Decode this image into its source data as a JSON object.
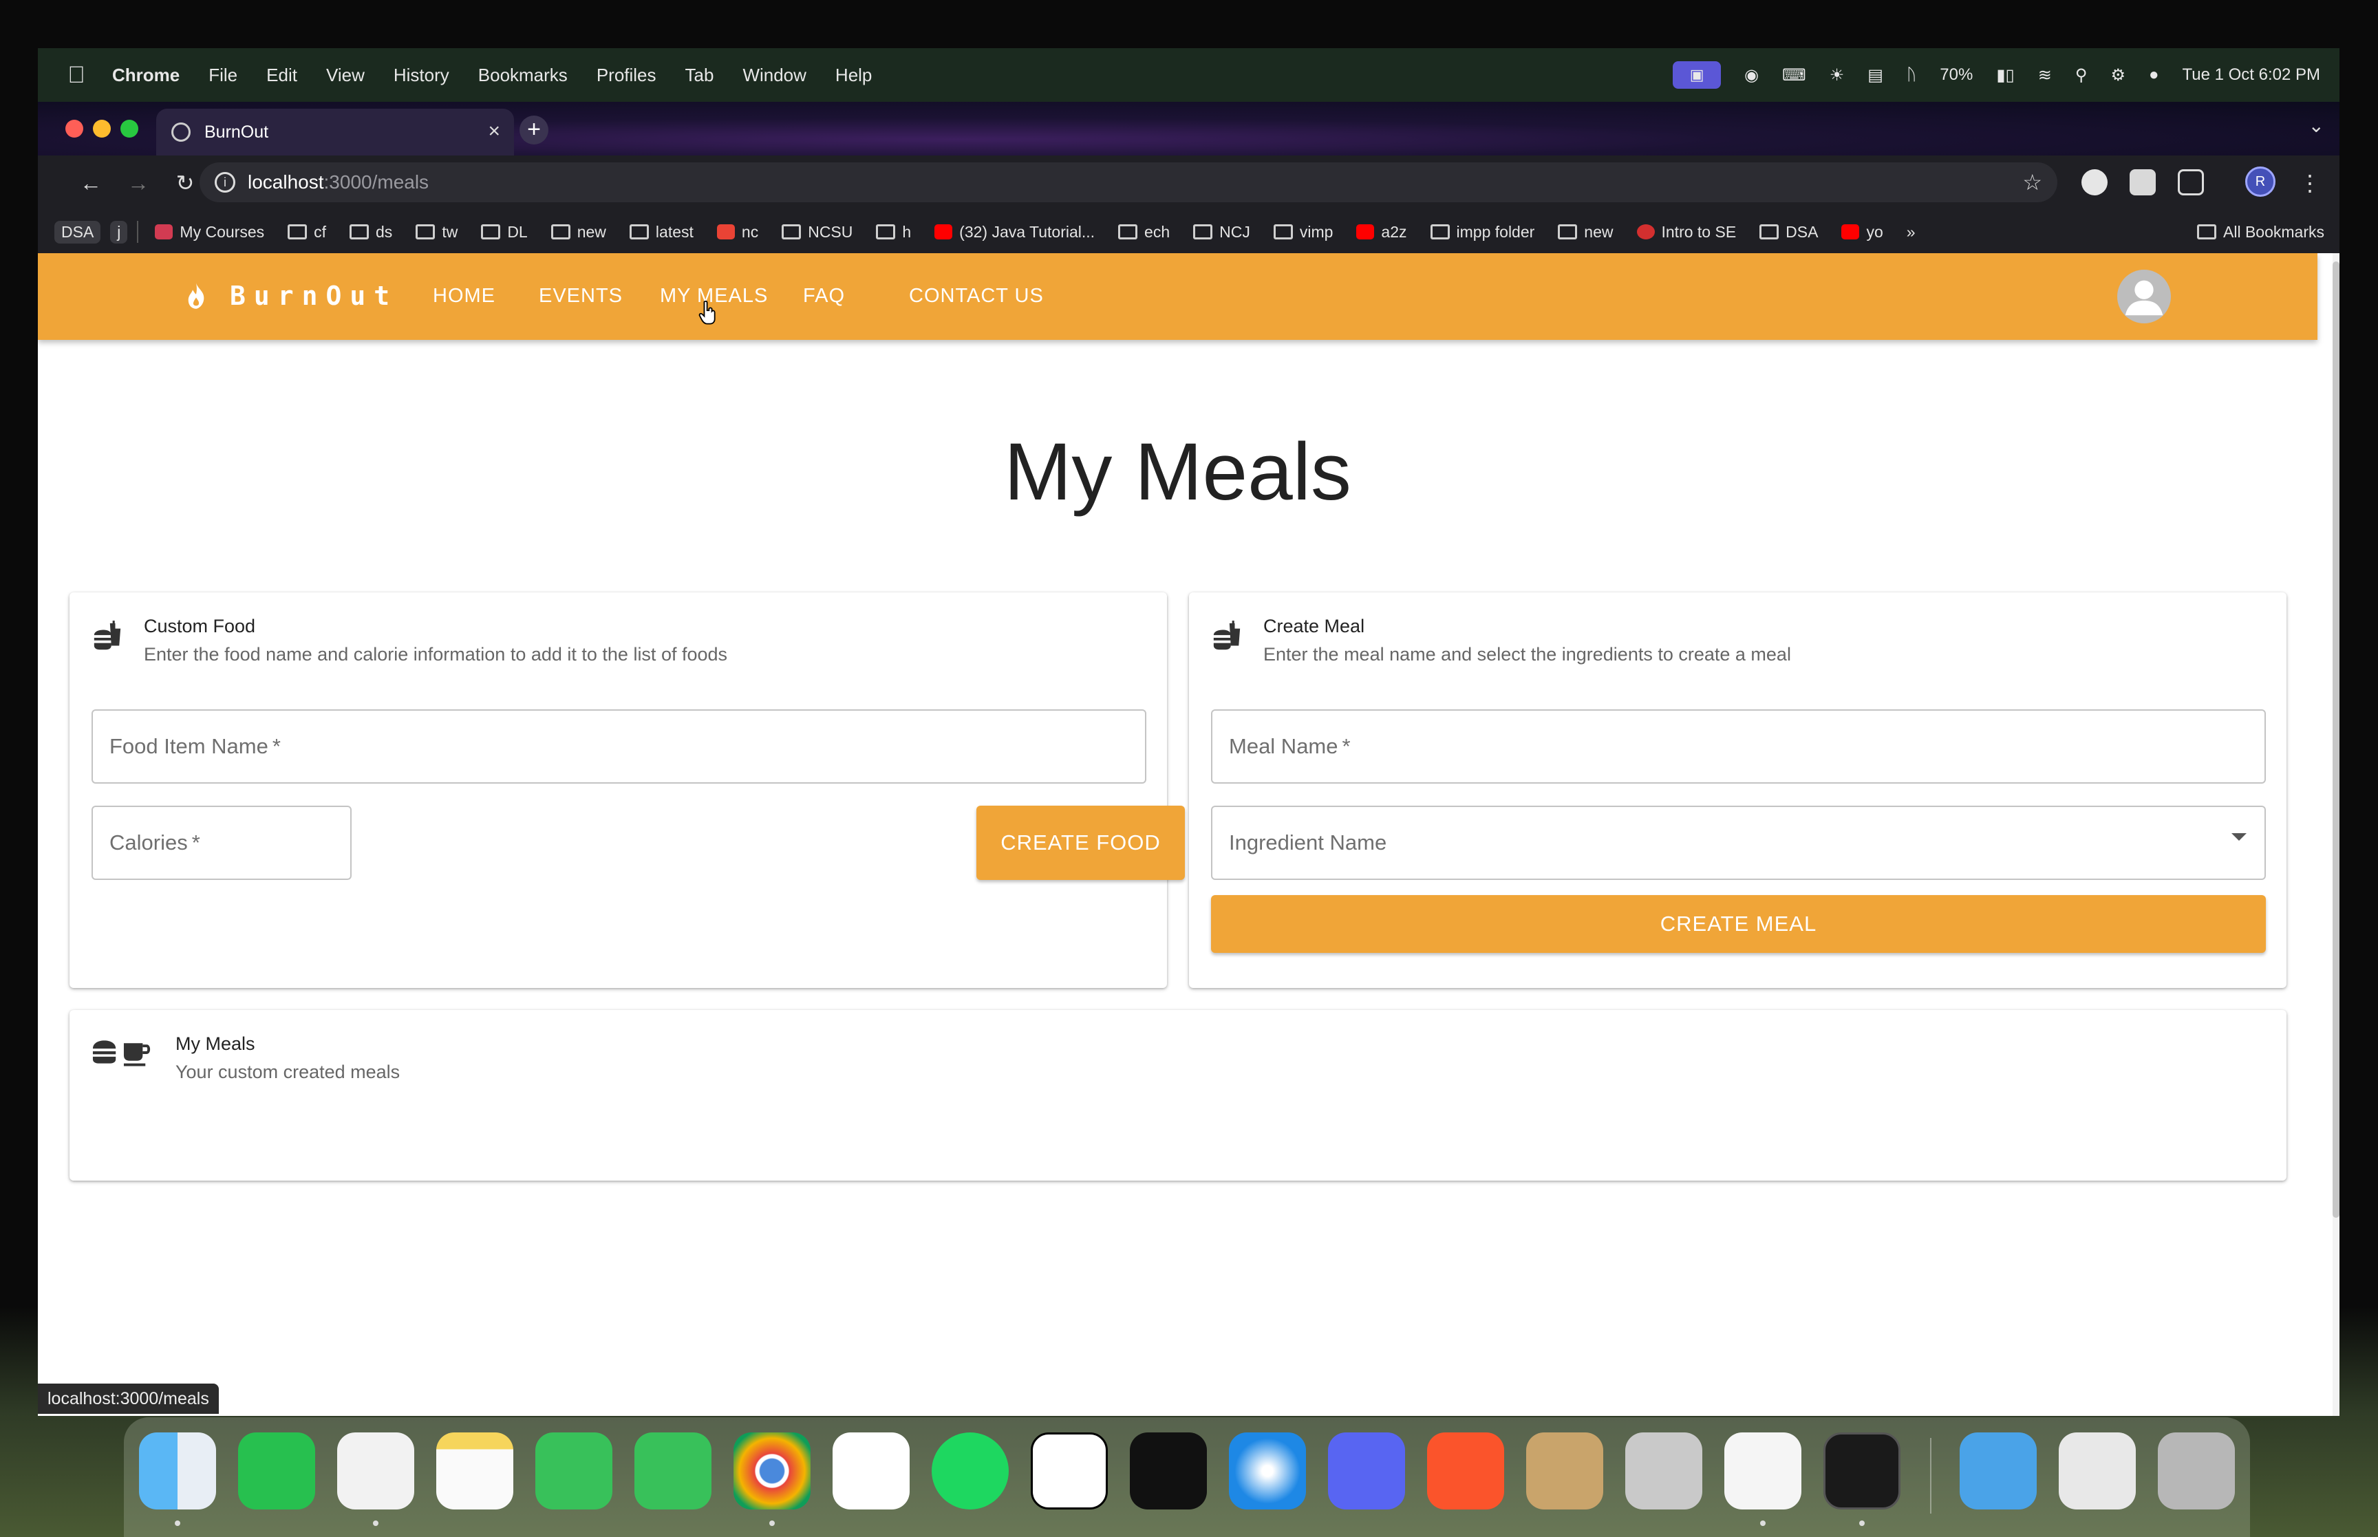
{
  "menubar": {
    "app": "Chrome",
    "items": [
      "File",
      "Edit",
      "View",
      "History",
      "Bookmarks",
      "Profiles",
      "Tab",
      "Window",
      "Help"
    ],
    "battery": "70%",
    "datetime": "Tue 1 Oct  6:02 PM"
  },
  "browser": {
    "tab_title": "BurnOut",
    "url_host": "localhost",
    "url_path": ":3000/meals",
    "profile_initial": "R",
    "bookmarks": [
      {
        "label": "DSA",
        "kind": "pill"
      },
      {
        "label": "j",
        "kind": "pill"
      },
      {
        "label": "My Courses",
        "kind": "fav",
        "color": "#d23b52"
      },
      {
        "label": "cf",
        "kind": "folder"
      },
      {
        "label": "ds",
        "kind": "folder"
      },
      {
        "label": "tw",
        "kind": "folder"
      },
      {
        "label": "DL",
        "kind": "folder"
      },
      {
        "label": "new",
        "kind": "folder"
      },
      {
        "label": "latest",
        "kind": "folder"
      },
      {
        "label": "nc",
        "kind": "fav",
        "color": "#ea4335"
      },
      {
        "label": "NCSU",
        "kind": "folder"
      },
      {
        "label": "h",
        "kind": "folder"
      },
      {
        "label": "(32) Java Tutorial...",
        "kind": "fav",
        "color": "#ff0000"
      },
      {
        "label": "ech",
        "kind": "folder"
      },
      {
        "label": "NCJ",
        "kind": "folder"
      },
      {
        "label": "vimp",
        "kind": "folder"
      },
      {
        "label": "a2z",
        "kind": "fav",
        "color": "#ff0000"
      },
      {
        "label": "impp folder",
        "kind": "folder"
      },
      {
        "label": "new",
        "kind": "folder"
      },
      {
        "label": "Intro to SE",
        "kind": "fav",
        "color": "#d32f2f"
      },
      {
        "label": "DSA",
        "kind": "folder"
      },
      {
        "label": "yo",
        "kind": "fav",
        "color": "#ff0000"
      }
    ],
    "overflow": "»",
    "all_bookmarks": "All Bookmarks",
    "status_url": "localhost:3000/meals"
  },
  "app": {
    "brand": "BurnOut",
    "nav": [
      "HOME",
      "EVENTS",
      "MY MEALS",
      "FAQ",
      "CONTACT US"
    ],
    "accent": "#f0a538"
  },
  "page": {
    "title": "My Meals",
    "custom_food": {
      "title": "Custom Food",
      "subtitle": "Enter the food name and calorie information to add it to the list of foods",
      "food_name_label": "Food Item Name",
      "calories_label": "Calories",
      "required_mark": "*",
      "button": "CREATE FOOD"
    },
    "create_meal": {
      "title": "Create Meal",
      "subtitle": "Enter the meal name and select the ingredients to create a meal",
      "meal_name_label": "Meal Name",
      "ingredient_label": "Ingredient Name",
      "required_mark": "*",
      "button": "CREATE MEAL"
    },
    "my_meals": {
      "title": "My Meals",
      "subtitle": "Your custom created meals"
    }
  },
  "dock": [
    "finder-icon",
    "whatsapp-icon",
    "vscode-icon",
    "notes-icon",
    "facetime-icon",
    "messages-icon",
    "chrome-icon",
    "todoist-icon",
    "spotify-icon",
    "notion-icon",
    "appletv-icon",
    "safari-icon",
    "discord-icon",
    "brave-icon",
    "archive-utility-icon",
    "iphone-mirroring-icon",
    "textedit-icon",
    "terminal-icon",
    "folder-icon",
    "pdf-document-icon",
    "trash-icon"
  ]
}
